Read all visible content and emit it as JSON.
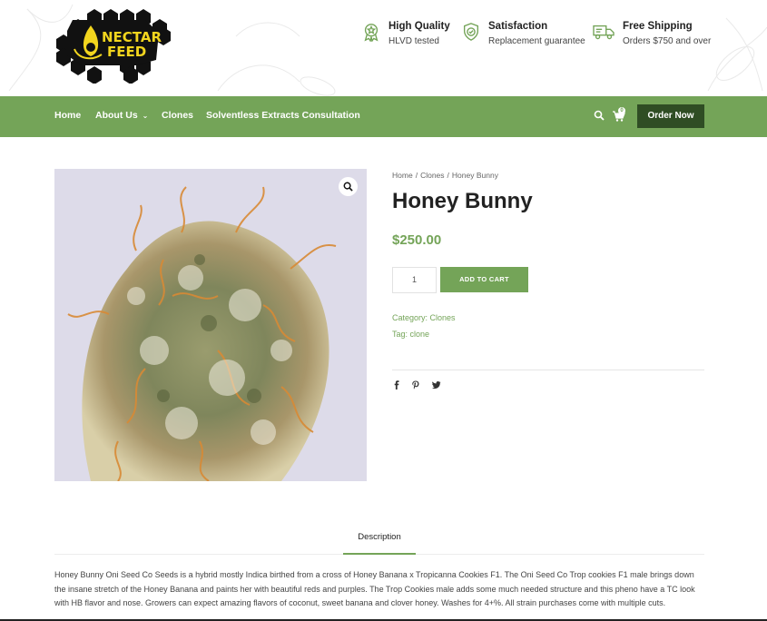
{
  "brand": {
    "logo_line1": "NECTAR",
    "logo_line2": "FEED"
  },
  "features": [
    {
      "icon": "quality-badge-icon",
      "title": "High Quality",
      "subtitle": "HLVD tested"
    },
    {
      "icon": "shield-check-icon",
      "title": "Satisfaction",
      "subtitle": "Replacement guarantee"
    },
    {
      "icon": "truck-icon",
      "title": "Free Shipping",
      "subtitle": "Orders $750 and over"
    }
  ],
  "nav": {
    "items": [
      "Home",
      "About Us",
      "Clones",
      "Solventless Extracts Consultation"
    ],
    "cart_count": "0",
    "order_button": "Order Now"
  },
  "breadcrumb": [
    "Home",
    "Clones",
    "Honey Bunny"
  ],
  "product": {
    "title": "Honey Bunny",
    "price": "$250.00",
    "quantity": "1",
    "add_to_cart": "ADD TO CART",
    "category_label": "Category:",
    "category": "Clones",
    "tag_label": "Tag:",
    "tag": "clone"
  },
  "share_icons": [
    "facebook-icon",
    "pinterest-icon",
    "twitter-icon"
  ],
  "tabs": {
    "description": "Description"
  },
  "description": "Honey Bunny Oni Seed Co Seeds is a hybrid mostly Indica birthed from a cross of Honey Banana x Tropicanna Cookies F1. The Oni Seed Co Trop cookies F1 male brings down the insane stretch of the Honey Banana and paints her with beautiful reds and purples. The Trop Cookies male adds some much needed structure and this pheno have a TC look with HB flavor and nose. Growers can expect amazing flavors of coconut, sweet banana and clover honey. Washes for 4+%. All strain purchases come with multiple cuts.",
  "colors": {
    "accent": "#74a458",
    "dark_button": "#2f4d24",
    "logo_yellow": "#f2d51e"
  }
}
